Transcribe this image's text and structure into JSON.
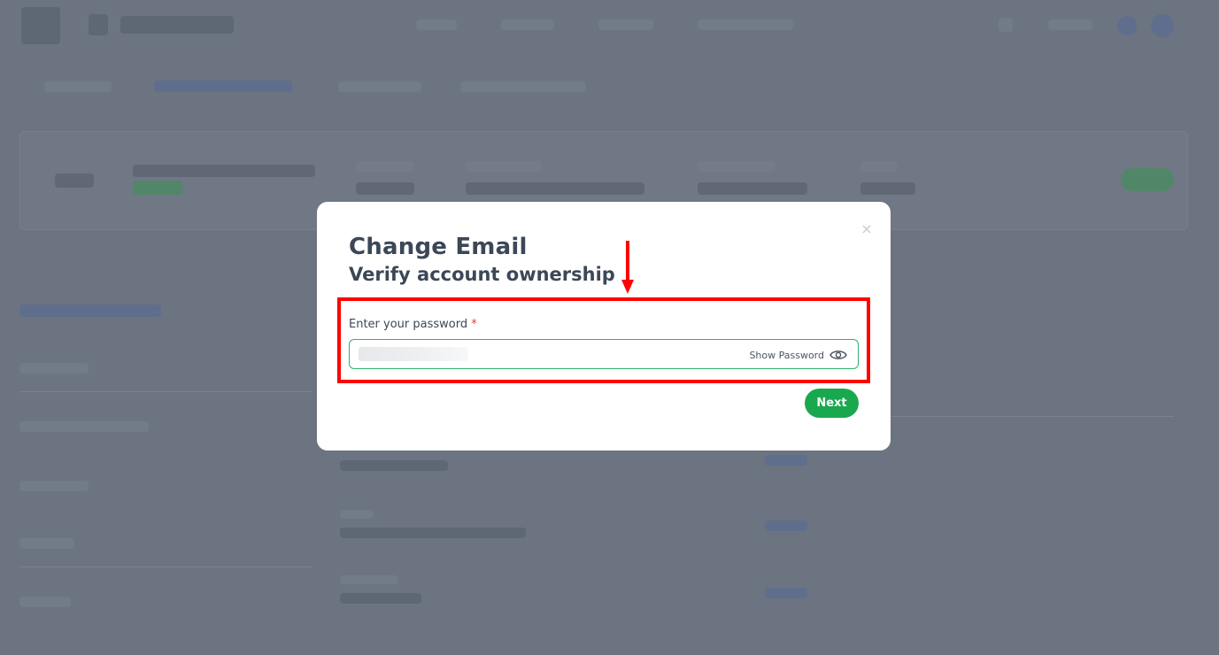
{
  "modal": {
    "title": "Change Email",
    "subtitle": "Verify account ownership",
    "close_glyph": "×",
    "password_label": "Enter your password",
    "required_marker": "*",
    "show_password_label": "Show Password",
    "next_label": "Next"
  },
  "icons": {
    "close": "close-icon",
    "eye": "eye-icon",
    "arrow": "annotation-arrow-icon"
  },
  "colors": {
    "overlay": "#6b7480",
    "accent_green": "#1aa84f",
    "input_border": "#2fb36d",
    "annotation_red": "#ff0000",
    "heading": "#3c4757"
  }
}
